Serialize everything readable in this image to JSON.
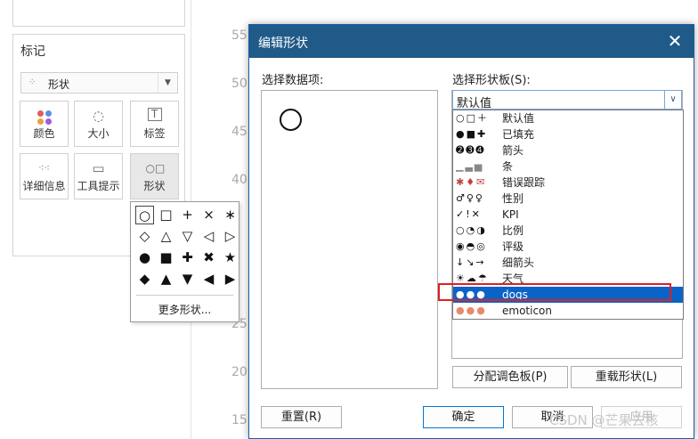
{
  "marks_panel": {
    "title": "标记",
    "mark_type": "形状",
    "buttons": [
      {
        "label": "颜色",
        "icon": "color-dots-icon"
      },
      {
        "label": "大小",
        "icon": "size-icon"
      },
      {
        "label": "标签",
        "icon": "label-icon"
      },
      {
        "label": "详细信息",
        "icon": "detail-dots-icon"
      },
      {
        "label": "工具提示",
        "icon": "tooltip-icon"
      },
      {
        "label": "形状",
        "icon": "shape-icon"
      }
    ]
  },
  "shape_popup": {
    "shapes": [
      "○",
      "□",
      "+",
      "×",
      "∗",
      "◇",
      "△",
      "▽",
      "◁",
      "▷",
      "●",
      "■",
      "✚",
      "✖",
      "★",
      "◆",
      "▲",
      "▼",
      "◀",
      "▶"
    ],
    "more_label": "更多形状..."
  },
  "axis_ticks": [
    "55",
    "50",
    "45",
    "40",
    "25",
    "20",
    "15"
  ],
  "dialog": {
    "title": "编辑形状",
    "data_items_label": "选择数据项:",
    "palette_label": "选择形状板(S):",
    "palette_value": "默认值",
    "palettes": [
      {
        "name": "默认值",
        "icons": "○□＋"
      },
      {
        "name": "已填充",
        "icons": "●■✚"
      },
      {
        "name": "箭头",
        "icons": "➋➌➍"
      },
      {
        "name": "条",
        "icons": "▁▃▅"
      },
      {
        "name": "错误跟踪",
        "icons": "✱♦✉"
      },
      {
        "name": "性别",
        "icons": "♂♀♀"
      },
      {
        "name": "KPI",
        "icons": "✓!✕"
      },
      {
        "name": "比例",
        "icons": "○◔◑"
      },
      {
        "name": "评级",
        "icons": "◉◓◎"
      },
      {
        "name": "细箭头",
        "icons": "↓↘→"
      },
      {
        "name": "天气",
        "icons": "☀☁☂"
      },
      {
        "name": "dogs",
        "icons": "●●●"
      },
      {
        "name": "emoticon",
        "icons": "●●●"
      }
    ],
    "selected_palette": "dogs",
    "assign_palette_button": "分配调色板(P)",
    "reload_shapes_button": "重载形状(L)",
    "reset_button": "重置(R)",
    "ok_button": "确定",
    "cancel_button": "取消",
    "apply_button": "应用"
  },
  "watermark": "CSDN @芒果去核",
  "colors": {
    "titlebar": "#205a88",
    "selection": "#0a64c8",
    "highlight_border": "#e0201f"
  }
}
